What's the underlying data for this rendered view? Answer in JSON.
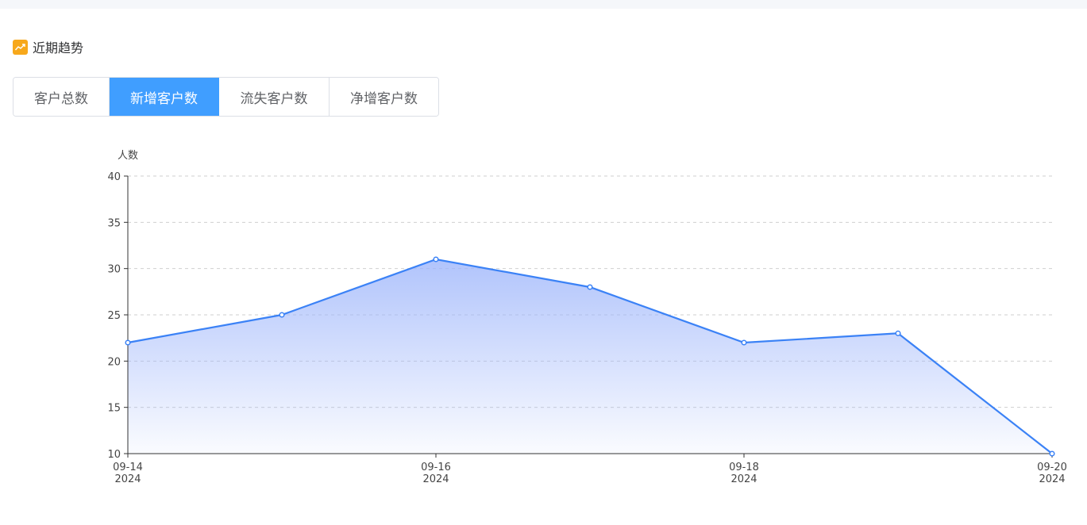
{
  "header": {
    "icon": "trend-icon",
    "title": "近期趋势"
  },
  "tabs": [
    {
      "label": "客户总数",
      "active": false
    },
    {
      "label": "新增客户数",
      "active": true
    },
    {
      "label": "流失客户数",
      "active": false
    },
    {
      "label": "净增客户数",
      "active": false
    }
  ],
  "colors": {
    "accent": "#409eff",
    "line": "#3b82f6",
    "icon": "#f7a81b"
  },
  "chart_data": {
    "type": "area",
    "ylabel": "人数",
    "ylim": [
      10,
      40
    ],
    "yticks": [
      10,
      15,
      20,
      25,
      30,
      35,
      40
    ],
    "x": [
      "2024-09-14",
      "2024-09-15",
      "2024-09-16",
      "2024-09-17",
      "2024-09-18",
      "2024-09-19",
      "2024-09-20"
    ],
    "x_tick_labels": [
      {
        "x": "2024-09-14",
        "line1": "09-14",
        "line2": "2024"
      },
      {
        "x": "2024-09-16",
        "line1": "09-16",
        "line2": "2024"
      },
      {
        "x": "2024-09-18",
        "line1": "09-18",
        "line2": "2024"
      },
      {
        "x": "2024-09-20",
        "line1": "09-20",
        "line2": "2024"
      }
    ],
    "values": [
      22,
      25,
      31,
      28,
      22,
      23,
      10
    ],
    "grid": true
  }
}
